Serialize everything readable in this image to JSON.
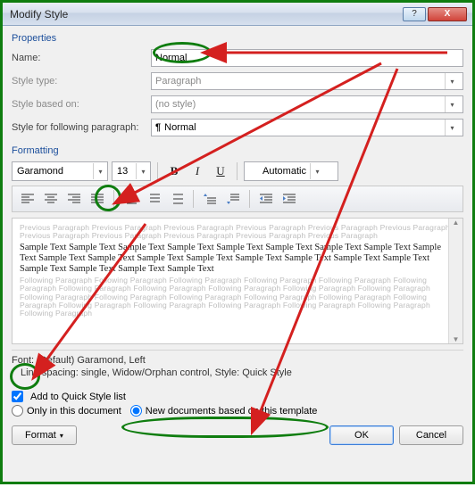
{
  "titlebar": {
    "title": "Modify Style",
    "help_glyph": "?",
    "close_glyph": "X"
  },
  "sections": {
    "properties": "Properties",
    "formatting": "Formatting"
  },
  "fields": {
    "name": {
      "label": "Name:",
      "value": "Normal"
    },
    "style_type": {
      "label": "Style type:",
      "value": "Paragraph"
    },
    "based_on": {
      "label": "Style based on:",
      "value": "(no style)"
    },
    "following": {
      "label": "Style for following paragraph:",
      "value": "Normal"
    }
  },
  "format_bar": {
    "font": "Garamond",
    "size": "13",
    "bold": "B",
    "italic": "I",
    "underline": "U",
    "color": "Automatic"
  },
  "preview": {
    "prev_para": "Previous Paragraph Previous Paragraph Previous Paragraph Previous Paragraph Previous Paragraph Previous Paragraph Previous Paragraph Previous Paragraph Previous Paragraph Previous Paragraph Previous Paragraph",
    "sample": "Sample Text Sample Text Sample Text Sample Text Sample Text Sample Text Sample Text Sample Text Sample Text Sample Text Sample Text Sample Text Sample Text Sample Text Sample Text Sample Text Sample Text Sample Text Sample Text Sample Text Sample Text",
    "next_para": "Following Paragraph Following Paragraph Following Paragraph Following Paragraph Following Paragraph Following Paragraph Following Paragraph Following Paragraph Following Paragraph Following Paragraph Following Paragraph Following Paragraph Following Paragraph Following Paragraph Following Paragraph Following Paragraph Following Paragraph Following Paragraph Following Paragraph Following Paragraph Following Paragraph Following Paragraph Following Paragraph"
  },
  "description": {
    "line1": "Font: (Default) Garamond, Left",
    "line2": "Line spacing:  single, Widow/Orphan control, Style: Quick Style"
  },
  "options": {
    "quick_style": "Add to Quick Style list",
    "only_doc": "Only in this document",
    "new_template": "New documents based on this template"
  },
  "buttons": {
    "format": "Format",
    "ok": "OK",
    "cancel": "Cancel"
  }
}
